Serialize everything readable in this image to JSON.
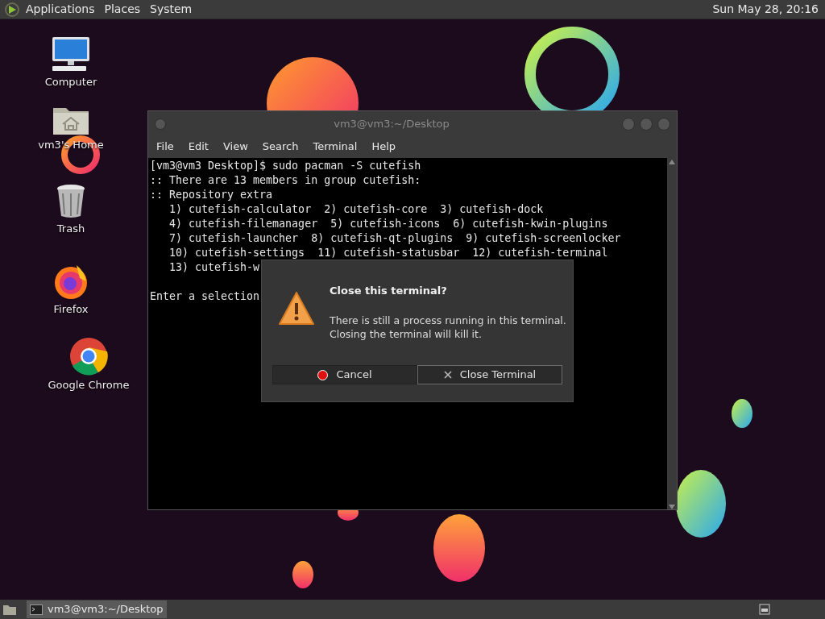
{
  "top_panel": {
    "menus": [
      "Applications",
      "Places",
      "System"
    ],
    "clock": "Sun May 28, 20:16"
  },
  "desktop_icons": [
    {
      "kind": "computer",
      "label": "Computer"
    },
    {
      "kind": "home",
      "label": "vm3's Home"
    },
    {
      "kind": "trash",
      "label": "Trash"
    },
    {
      "kind": "firefox",
      "label": "Firefox"
    },
    {
      "kind": "chrome",
      "label": "Google Chrome"
    }
  ],
  "terminal": {
    "title": "vm3@vm3:~/Desktop",
    "menu": [
      "File",
      "Edit",
      "View",
      "Search",
      "Terminal",
      "Help"
    ],
    "lines": [
      "[vm3@vm3 Desktop]$ sudo pacman -S cutefish",
      ":: There are 13 members in group cutefish:",
      ":: Repository extra",
      "   1) cutefish-calculator  2) cutefish-core  3) cutefish-dock",
      "   4) cutefish-filemanager  5) cutefish-icons  6) cutefish-kwin-plugins",
      "   7) cutefish-launcher  8) cutefish-qt-plugins  9) cutefish-screenlocker",
      "   10) cutefish-settings  11) cutefish-statusbar  12) cutefish-terminal",
      "   13) cutefish-w"
    ],
    "prompt": "Enter a selection"
  },
  "dialog": {
    "title": "Close this terminal?",
    "message": [
      "There is still a process running in this terminal.",
      "Closing the terminal will kill it."
    ],
    "buttons": [
      {
        "kind": "cancel",
        "label": "Cancel",
        "focused": false
      },
      {
        "kind": "close",
        "label": "Close Terminal",
        "focused": true
      }
    ]
  },
  "taskbar": {
    "items": [
      {
        "label": "vm3@vm3:~/Desktop",
        "selected": true
      }
    ]
  }
}
